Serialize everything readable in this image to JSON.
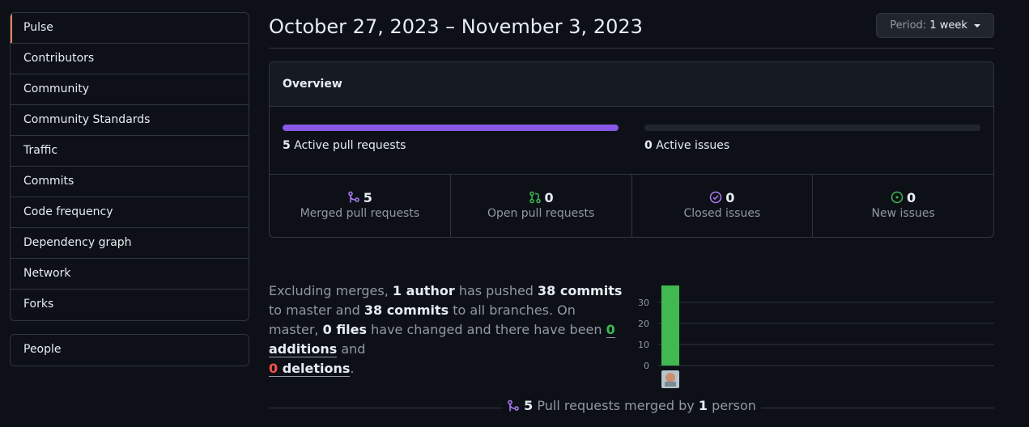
{
  "sidebar": {
    "items": [
      {
        "label": "Pulse"
      },
      {
        "label": "Contributors"
      },
      {
        "label": "Community"
      },
      {
        "label": "Community Standards"
      },
      {
        "label": "Traffic"
      },
      {
        "label": "Commits"
      },
      {
        "label": "Code frequency"
      },
      {
        "label": "Dependency graph"
      },
      {
        "label": "Network"
      },
      {
        "label": "Forks"
      }
    ],
    "people": "People"
  },
  "header": {
    "date_range": "October 27, 2023 – November 3, 2023",
    "period_label": "Period:",
    "period_value": "1 week"
  },
  "overview": {
    "title": "Overview",
    "active_prs_count": "5",
    "active_prs_label": "Active pull requests",
    "active_prs_fraction": 1.0,
    "active_issues_count": "0",
    "active_issues_label": "Active issues",
    "active_issues_fraction": 0.0,
    "stats": [
      {
        "icon": "merged-pr-icon",
        "value": "5",
        "label": "Merged pull requests"
      },
      {
        "icon": "open-pr-icon",
        "value": "0",
        "label": "Open pull requests"
      },
      {
        "icon": "closed-issue-icon",
        "value": "0",
        "label": "Closed issues"
      },
      {
        "icon": "new-issue-icon",
        "value": "0",
        "label": "New issues"
      }
    ]
  },
  "summary": {
    "p1": "Excluding merges,",
    "authors": "1 author",
    "p2": "has pushed",
    "commits_master": "38 commits",
    "p3": "to master and",
    "commits_all": "38 commits",
    "p4": "to all branches. On master,",
    "files": "0 files",
    "p5": "have changed and there have been",
    "additions_n": "0",
    "additions_word": "additions",
    "p6": "and",
    "deletions_n": "0",
    "deletions_word": "deletions",
    "p7": "."
  },
  "chart_data": {
    "type": "bar",
    "categories": [
      "author-1"
    ],
    "values": [
      38
    ],
    "ylim": [
      0,
      38
    ],
    "yticks": [
      "0",
      "10",
      "20",
      "30"
    ],
    "bar_color": "#3fb950"
  },
  "merged": {
    "count": "5",
    "text": "Pull requests merged by",
    "people": "1",
    "suffix": "person"
  },
  "colors": {
    "accent": "#f78166",
    "purple": "#8957e5",
    "green": "#3fb950",
    "red": "#f85149"
  }
}
